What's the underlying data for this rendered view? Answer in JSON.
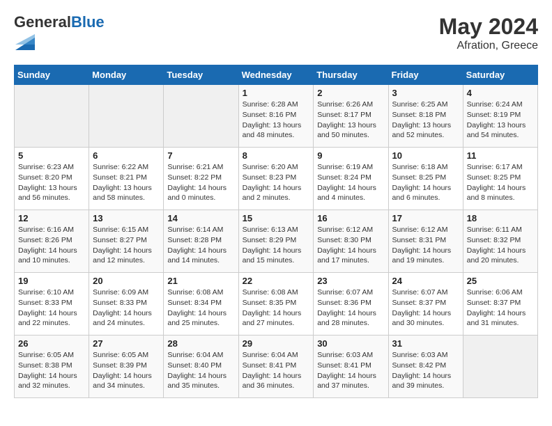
{
  "header": {
    "logo_general": "General",
    "logo_blue": "Blue",
    "month_year": "May 2024",
    "location": "Afration, Greece"
  },
  "weekdays": [
    "Sunday",
    "Monday",
    "Tuesday",
    "Wednesday",
    "Thursday",
    "Friday",
    "Saturday"
  ],
  "weeks": [
    [
      {
        "day": "",
        "sunrise": "",
        "sunset": "",
        "daylight": ""
      },
      {
        "day": "",
        "sunrise": "",
        "sunset": "",
        "daylight": ""
      },
      {
        "day": "",
        "sunrise": "",
        "sunset": "",
        "daylight": ""
      },
      {
        "day": "1",
        "sunrise": "Sunrise: 6:28 AM",
        "sunset": "Sunset: 8:16 PM",
        "daylight": "Daylight: 13 hours and 48 minutes."
      },
      {
        "day": "2",
        "sunrise": "Sunrise: 6:26 AM",
        "sunset": "Sunset: 8:17 PM",
        "daylight": "Daylight: 13 hours and 50 minutes."
      },
      {
        "day": "3",
        "sunrise": "Sunrise: 6:25 AM",
        "sunset": "Sunset: 8:18 PM",
        "daylight": "Daylight: 13 hours and 52 minutes."
      },
      {
        "day": "4",
        "sunrise": "Sunrise: 6:24 AM",
        "sunset": "Sunset: 8:19 PM",
        "daylight": "Daylight: 13 hours and 54 minutes."
      }
    ],
    [
      {
        "day": "5",
        "sunrise": "Sunrise: 6:23 AM",
        "sunset": "Sunset: 8:20 PM",
        "daylight": "Daylight: 13 hours and 56 minutes."
      },
      {
        "day": "6",
        "sunrise": "Sunrise: 6:22 AM",
        "sunset": "Sunset: 8:21 PM",
        "daylight": "Daylight: 13 hours and 58 minutes."
      },
      {
        "day": "7",
        "sunrise": "Sunrise: 6:21 AM",
        "sunset": "Sunset: 8:22 PM",
        "daylight": "Daylight: 14 hours and 0 minutes."
      },
      {
        "day": "8",
        "sunrise": "Sunrise: 6:20 AM",
        "sunset": "Sunset: 8:23 PM",
        "daylight": "Daylight: 14 hours and 2 minutes."
      },
      {
        "day": "9",
        "sunrise": "Sunrise: 6:19 AM",
        "sunset": "Sunset: 8:24 PM",
        "daylight": "Daylight: 14 hours and 4 minutes."
      },
      {
        "day": "10",
        "sunrise": "Sunrise: 6:18 AM",
        "sunset": "Sunset: 8:25 PM",
        "daylight": "Daylight: 14 hours and 6 minutes."
      },
      {
        "day": "11",
        "sunrise": "Sunrise: 6:17 AM",
        "sunset": "Sunset: 8:25 PM",
        "daylight": "Daylight: 14 hours and 8 minutes."
      }
    ],
    [
      {
        "day": "12",
        "sunrise": "Sunrise: 6:16 AM",
        "sunset": "Sunset: 8:26 PM",
        "daylight": "Daylight: 14 hours and 10 minutes."
      },
      {
        "day": "13",
        "sunrise": "Sunrise: 6:15 AM",
        "sunset": "Sunset: 8:27 PM",
        "daylight": "Daylight: 14 hours and 12 minutes."
      },
      {
        "day": "14",
        "sunrise": "Sunrise: 6:14 AM",
        "sunset": "Sunset: 8:28 PM",
        "daylight": "Daylight: 14 hours and 14 minutes."
      },
      {
        "day": "15",
        "sunrise": "Sunrise: 6:13 AM",
        "sunset": "Sunset: 8:29 PM",
        "daylight": "Daylight: 14 hours and 15 minutes."
      },
      {
        "day": "16",
        "sunrise": "Sunrise: 6:12 AM",
        "sunset": "Sunset: 8:30 PM",
        "daylight": "Daylight: 14 hours and 17 minutes."
      },
      {
        "day": "17",
        "sunrise": "Sunrise: 6:12 AM",
        "sunset": "Sunset: 8:31 PM",
        "daylight": "Daylight: 14 hours and 19 minutes."
      },
      {
        "day": "18",
        "sunrise": "Sunrise: 6:11 AM",
        "sunset": "Sunset: 8:32 PM",
        "daylight": "Daylight: 14 hours and 20 minutes."
      }
    ],
    [
      {
        "day": "19",
        "sunrise": "Sunrise: 6:10 AM",
        "sunset": "Sunset: 8:33 PM",
        "daylight": "Daylight: 14 hours and 22 minutes."
      },
      {
        "day": "20",
        "sunrise": "Sunrise: 6:09 AM",
        "sunset": "Sunset: 8:33 PM",
        "daylight": "Daylight: 14 hours and 24 minutes."
      },
      {
        "day": "21",
        "sunrise": "Sunrise: 6:08 AM",
        "sunset": "Sunset: 8:34 PM",
        "daylight": "Daylight: 14 hours and 25 minutes."
      },
      {
        "day": "22",
        "sunrise": "Sunrise: 6:08 AM",
        "sunset": "Sunset: 8:35 PM",
        "daylight": "Daylight: 14 hours and 27 minutes."
      },
      {
        "day": "23",
        "sunrise": "Sunrise: 6:07 AM",
        "sunset": "Sunset: 8:36 PM",
        "daylight": "Daylight: 14 hours and 28 minutes."
      },
      {
        "day": "24",
        "sunrise": "Sunrise: 6:07 AM",
        "sunset": "Sunset: 8:37 PM",
        "daylight": "Daylight: 14 hours and 30 minutes."
      },
      {
        "day": "25",
        "sunrise": "Sunrise: 6:06 AM",
        "sunset": "Sunset: 8:37 PM",
        "daylight": "Daylight: 14 hours and 31 minutes."
      }
    ],
    [
      {
        "day": "26",
        "sunrise": "Sunrise: 6:05 AM",
        "sunset": "Sunset: 8:38 PM",
        "daylight": "Daylight: 14 hours and 32 minutes."
      },
      {
        "day": "27",
        "sunrise": "Sunrise: 6:05 AM",
        "sunset": "Sunset: 8:39 PM",
        "daylight": "Daylight: 14 hours and 34 minutes."
      },
      {
        "day": "28",
        "sunrise": "Sunrise: 6:04 AM",
        "sunset": "Sunset: 8:40 PM",
        "daylight": "Daylight: 14 hours and 35 minutes."
      },
      {
        "day": "29",
        "sunrise": "Sunrise: 6:04 AM",
        "sunset": "Sunset: 8:41 PM",
        "daylight": "Daylight: 14 hours and 36 minutes."
      },
      {
        "day": "30",
        "sunrise": "Sunrise: 6:03 AM",
        "sunset": "Sunset: 8:41 PM",
        "daylight": "Daylight: 14 hours and 37 minutes."
      },
      {
        "day": "31",
        "sunrise": "Sunrise: 6:03 AM",
        "sunset": "Sunset: 8:42 PM",
        "daylight": "Daylight: 14 hours and 39 minutes."
      },
      {
        "day": "",
        "sunrise": "",
        "sunset": "",
        "daylight": ""
      }
    ]
  ]
}
